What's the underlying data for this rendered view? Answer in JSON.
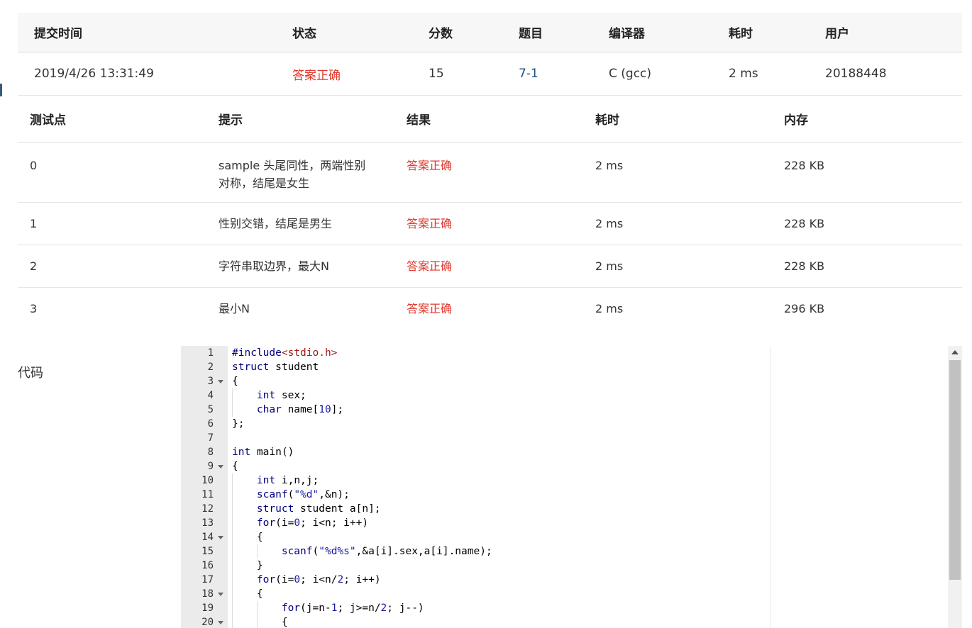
{
  "submission": {
    "headers": [
      "提交时间",
      "状态",
      "分数",
      "题目",
      "编译器",
      "耗时",
      "用户"
    ],
    "time": "2019/4/26 13:31:49",
    "status": "答案正确",
    "score": "15",
    "problem": "7-1",
    "compiler": "C (gcc)",
    "elapsed": "2 ms",
    "user": "20188448"
  },
  "tests": {
    "headers": [
      "测试点",
      "提示",
      "结果",
      "耗时",
      "内存"
    ],
    "rows": [
      {
        "id": "0",
        "hint": "sample 头尾同性，两端性别对称，结尾是女生",
        "hint_l1": "sample 头尾同性，两端性别",
        "hint_l2": "对称，结尾是女生",
        "result": "答案正确",
        "time": "2 ms",
        "memory": "228 KB"
      },
      {
        "id": "1",
        "hint_l1": "性别交错，结尾是男生",
        "hint_l2": "",
        "result": "答案正确",
        "time": "2 ms",
        "memory": "228 KB"
      },
      {
        "id": "2",
        "hint_l1": "字符串取边界，最大N",
        "hint_l2": "",
        "result": "答案正确",
        "time": "2 ms",
        "memory": "228 KB"
      },
      {
        "id": "3",
        "hint_l1": "最小N",
        "hint_l2": "",
        "result": "答案正确",
        "time": "2 ms",
        "memory": "296 KB"
      }
    ]
  },
  "code_label": "代码",
  "code_lines": [
    "#include<stdio.h>",
    "struct student",
    "{",
    "    int sex;",
    "    char name[10];",
    "};",
    "",
    "int main()",
    "{",
    "    int i,n,j;",
    "    scanf(\"%d\",&n);",
    "    struct student a[n];",
    "    for(i=0; i<n; i++)",
    "    {",
    "        scanf(\"%d%s\",&a[i].sex,a[i].name);",
    "    }",
    "    for(i=0; i<n/2; i++)",
    "    {",
    "        for(j=n-1; j>=n/2; j--)",
    "        {"
  ],
  "line_numbers": [
    "1",
    "2",
    "3",
    "4",
    "5",
    "6",
    "7",
    "8",
    "9",
    "10",
    "11",
    "12",
    "13",
    "14",
    "15",
    "16",
    "17",
    "18",
    "19",
    "20"
  ],
  "fold_lines": [
    3,
    9,
    14,
    18,
    20
  ],
  "colors": {
    "accent_red": "#e0382c",
    "link_blue": "#1f4e8c"
  }
}
